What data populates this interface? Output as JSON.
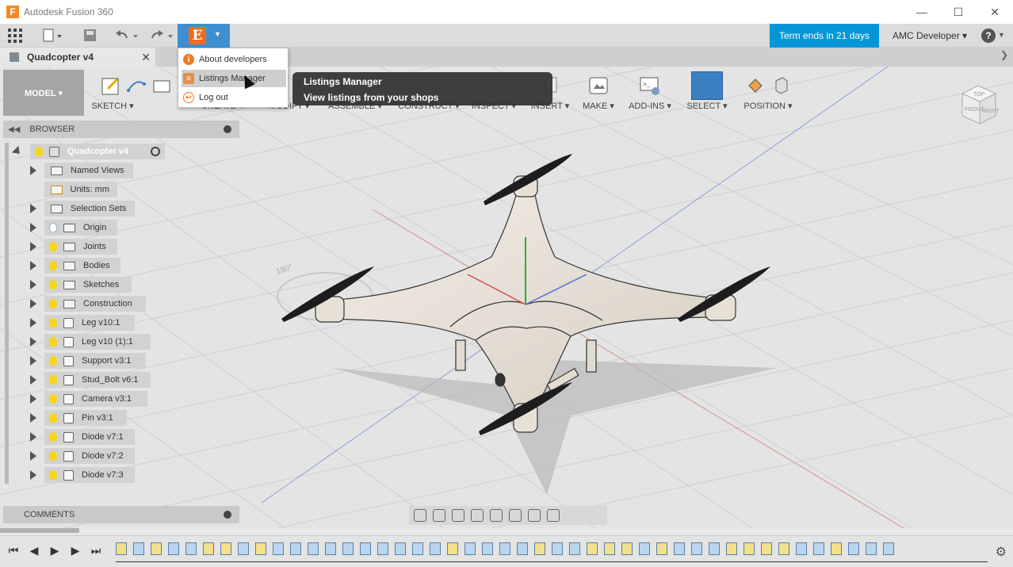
{
  "window": {
    "app_title": "Autodesk Fusion 360",
    "logo_letter": "F",
    "controls": [
      "—",
      "☐",
      "✕"
    ]
  },
  "quick_access": {
    "term_label": "Term ends in 21 days",
    "user_label": "AMC Developer ▾",
    "help_label": "?",
    "e_logo_letter": "E"
  },
  "document": {
    "tab_name": "Quadcopter v4",
    "close_glyph": "✕",
    "next_glyph": "❯"
  },
  "toolbar": {
    "model_label": "MODEL ▾",
    "groups": [
      {
        "label": "SKETCH ▾"
      },
      {
        "label": "CREATE ▾"
      },
      {
        "label": "MODIFY ▾"
      },
      {
        "label": "ASSEMBLE ▾"
      },
      {
        "label": "CONSTRUCT ▾"
      },
      {
        "label": "INSPECT ▾"
      },
      {
        "label": "INSERT ▾"
      },
      {
        "label": "MAKE ▾"
      },
      {
        "label": "ADD-INS ▾"
      },
      {
        "label": "SELECT ▾"
      },
      {
        "label": "POSITION ▾"
      }
    ]
  },
  "menu": {
    "items": [
      {
        "label": "About developers",
        "icon": "info-icon",
        "glyph": "i"
      },
      {
        "label": "Listings Manager",
        "icon": "listings-icon",
        "glyph": "≡"
      },
      {
        "label": "Log out",
        "icon": "logout-icon",
        "glyph": "↩"
      }
    ]
  },
  "tooltip": {
    "title": "Listings Manager",
    "description": "View listings from your shops"
  },
  "browser": {
    "title": "BROWSER",
    "root": "Quadcopter v4",
    "items": [
      {
        "label": "Named Views"
      },
      {
        "label": "Units: mm"
      },
      {
        "label": "Selection Sets"
      },
      {
        "label": "Origin"
      },
      {
        "label": "Joints"
      },
      {
        "label": "Bodies"
      },
      {
        "label": "Sketches"
      },
      {
        "label": "Construction"
      },
      {
        "label": "Leg v10:1"
      },
      {
        "label": "Leg v10 (1):1"
      },
      {
        "label": "Support v3:1"
      },
      {
        "label": "Stud_Bolt v6:1"
      },
      {
        "label": "Camera v3:1"
      },
      {
        "label": "Pin v3:1"
      },
      {
        "label": "Diode v7:1"
      },
      {
        "label": "Diode v7:2"
      },
      {
        "label": "Diode v7:3"
      }
    ]
  },
  "comments": {
    "title": "COMMENTS"
  },
  "viewport": {
    "angle_label": "180°"
  },
  "viewcube": {
    "top": "TOP",
    "front": "FRONT",
    "right": "RIGHT"
  },
  "timeline": {
    "controls": [
      "⏮",
      "◀",
      "▶",
      "▶",
      "⏭"
    ],
    "settings_glyph": "⚙"
  },
  "colors": {
    "accent_blue": "#0696d7",
    "e_button_bg": "#3d8fd0",
    "e_logo_orange": "#f26b21",
    "select_highlight": "#3b7fc0"
  }
}
